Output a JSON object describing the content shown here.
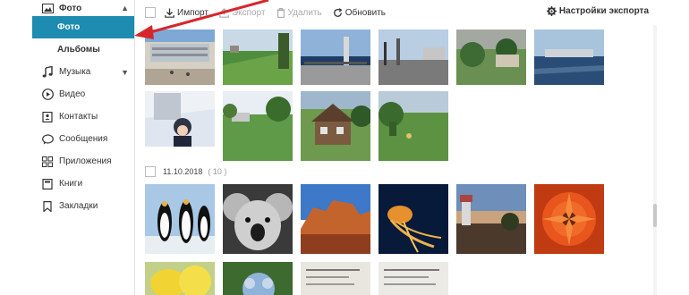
{
  "sidebar": {
    "photos_header": "Фото",
    "photo_item": "Фото",
    "albums_item": "Альбомы",
    "items": [
      {
        "label": "Музыка",
        "icon": "music-note-icon"
      },
      {
        "label": "Видео",
        "icon": "play-circle-icon"
      },
      {
        "label": "Контакты",
        "icon": "contact-card-icon"
      },
      {
        "label": "Сообщения",
        "icon": "chat-bubble-icon"
      },
      {
        "label": "Приложения",
        "icon": "apps-grid-icon"
      },
      {
        "label": "Книги",
        "icon": "book-icon"
      },
      {
        "label": "Закладки",
        "icon": "bookmark-icon"
      }
    ]
  },
  "toolbar": {
    "import_label": "Импорт",
    "export_label": "Экспорт",
    "delete_label": "Удалить",
    "refresh_label": "Обновить",
    "settings_label": "Настройки экспорта"
  },
  "group": {
    "date": "11.10.2018",
    "count": "( 10 )"
  },
  "colors": {
    "accent": "#1e8bb0",
    "arrow": "#d7262b"
  }
}
